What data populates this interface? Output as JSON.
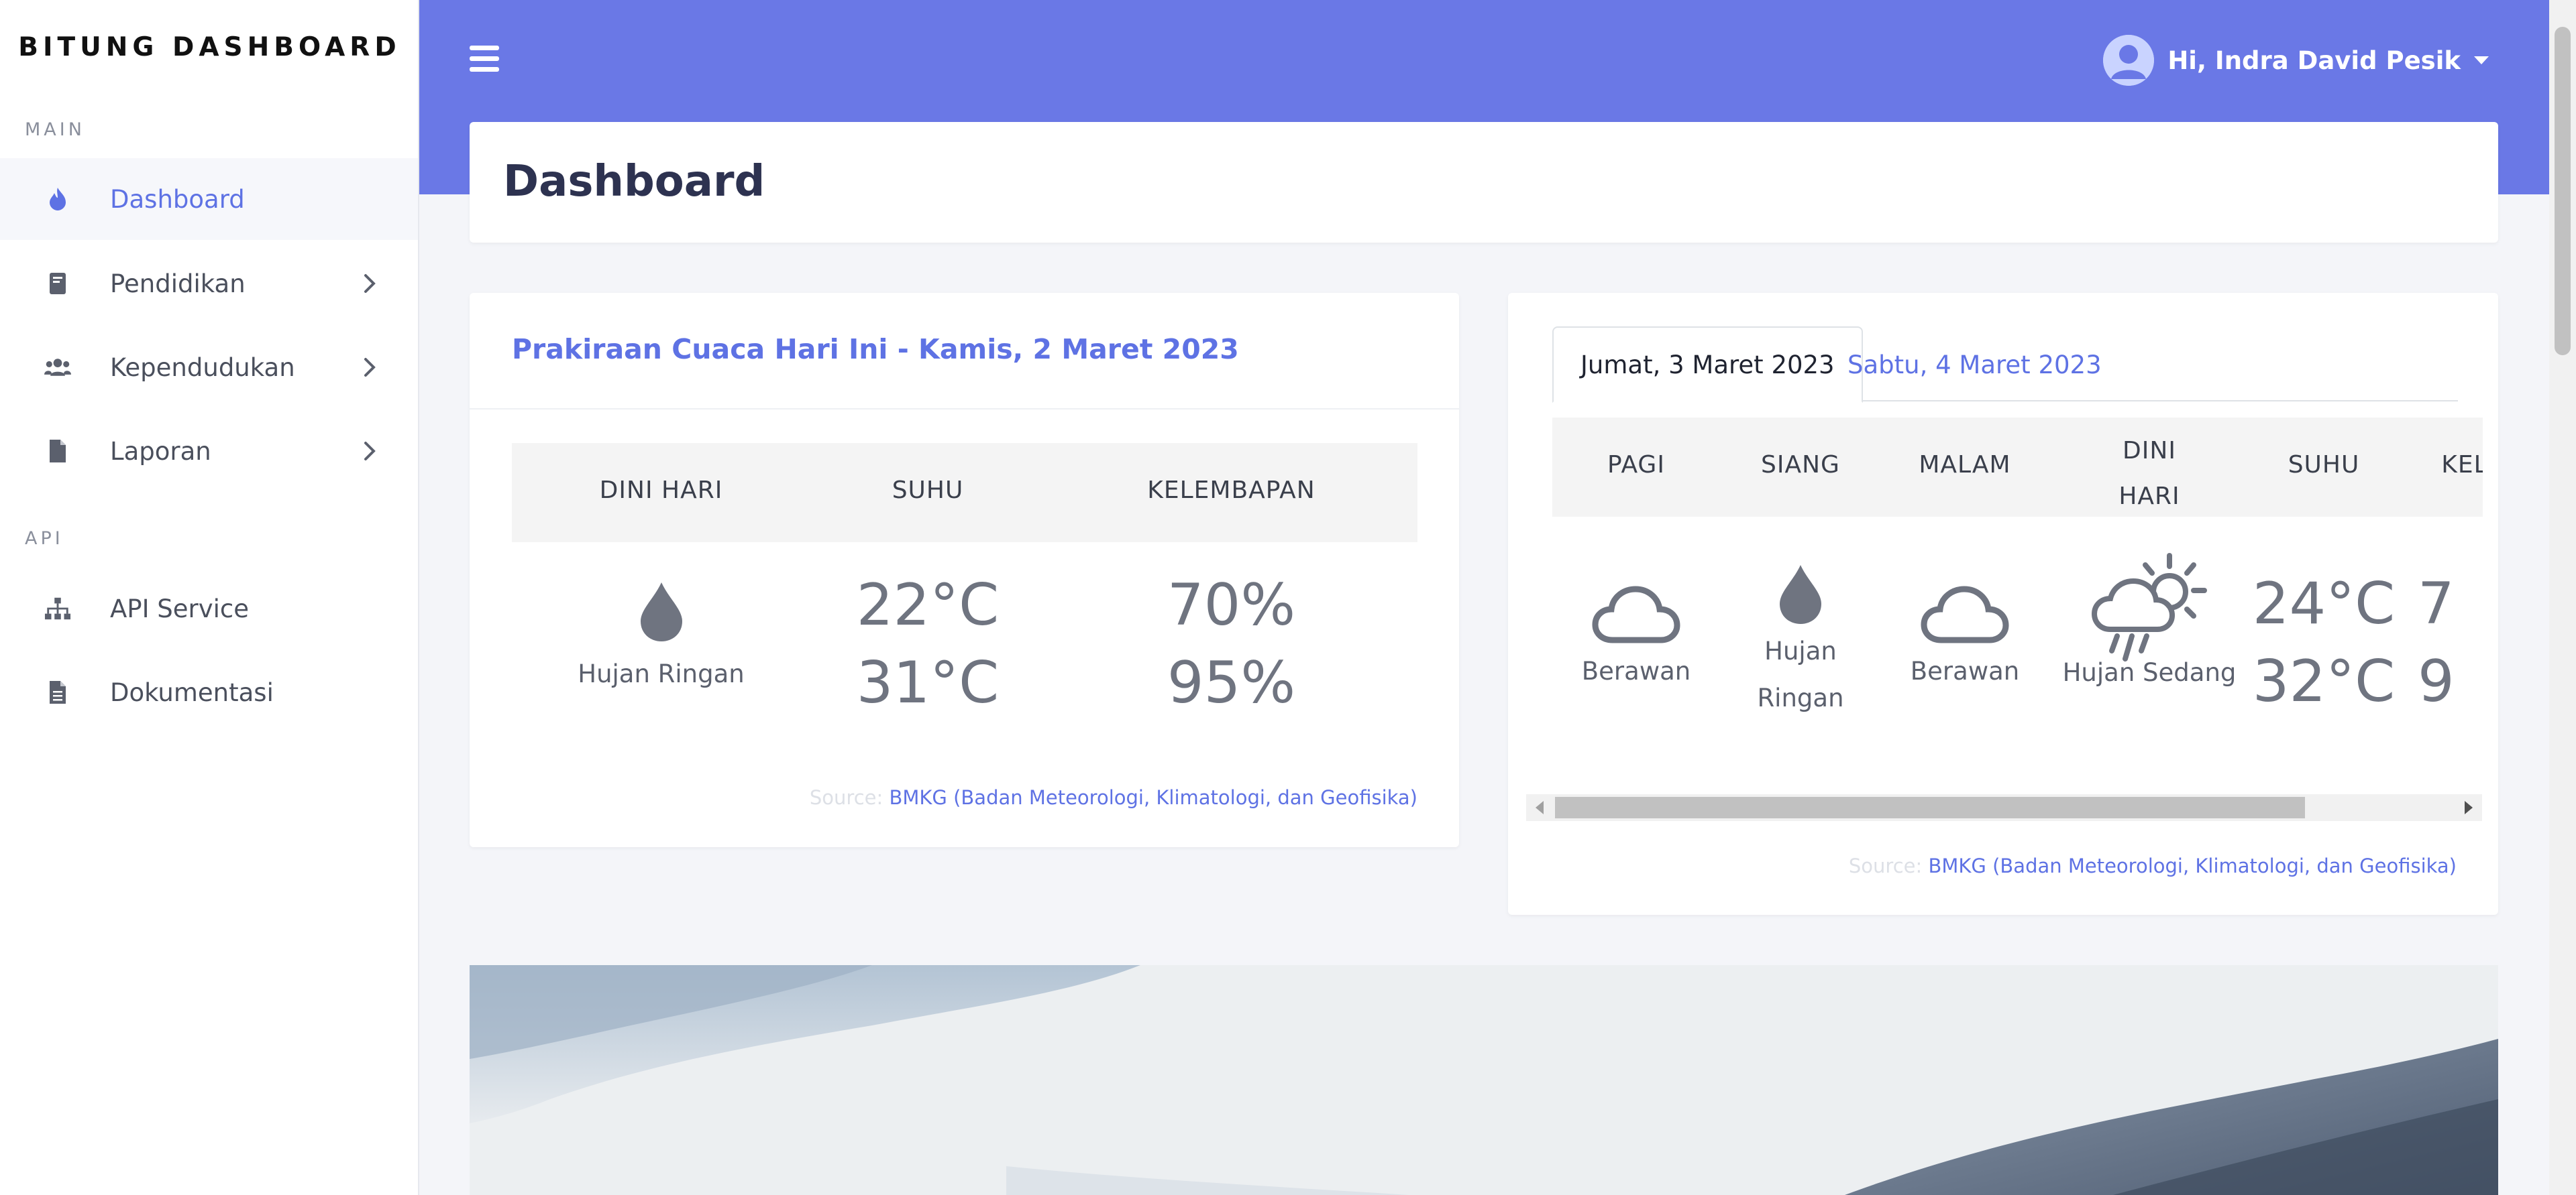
{
  "sidebar": {
    "brand": "BITUNG DASHBOARD",
    "section_main": "MAIN",
    "section_api": "API",
    "items": [
      {
        "label": "Dashboard",
        "icon": "fire-icon"
      },
      {
        "label": "Pendidikan",
        "icon": "book-icon"
      },
      {
        "label": "Kependudukan",
        "icon": "users-icon"
      },
      {
        "label": "Laporan",
        "icon": "file-icon"
      },
      {
        "label": "API Service",
        "icon": "sitemap-icon"
      },
      {
        "label": "Dokumentasi",
        "icon": "document-icon"
      }
    ]
  },
  "header": {
    "user_greeting": "Hi, Indra David Pesik"
  },
  "page": {
    "title": "Dashboard"
  },
  "today_card": {
    "title": "Prakiraan Cuaca Hari Ini - Kamis, 2 Maret 2023",
    "columns": [
      "DINI HARI",
      "SUHU",
      "KELEMBAPAN"
    ],
    "weather": {
      "icon": "raindrop-icon",
      "label": "Hujan Ringan"
    },
    "temp_min": "22°C",
    "temp_max": "31°C",
    "humidity_min": "70%",
    "humidity_max": "95%",
    "source_label": "Source:",
    "source_link": "BMKG (Badan Meteorologi, Klimatologi, dan Geofisika)"
  },
  "forecast_card": {
    "tabs": [
      "Jumat, 3 Maret 2023",
      "Sabtu, 4 Maret 2023"
    ],
    "columns": [
      "PAGI",
      "SIANG",
      "MALAM",
      "DINI HARI",
      "SUHU",
      "KEL"
    ],
    "column_dini_line1": "DINI",
    "column_dini_line2": "HARI",
    "pagi": {
      "icon": "cloud-icon",
      "label": "Berawan"
    },
    "siang": {
      "icon": "raindrop-icon",
      "label_line1": "Hujan",
      "label_line2": "Ringan"
    },
    "malam": {
      "icon": "cloud-icon",
      "label": "Berawan"
    },
    "dini": {
      "icon": "cloud-sun-rain-icon",
      "label": "Hujan Sedang"
    },
    "temp_min": "24°C",
    "temp_max": "32°C",
    "kel_partial_1": "7",
    "kel_partial_2": "9",
    "source_label": "Source:",
    "source_link": "BMKG (Badan Meteorologi, Klimatologi, dan Geofisika)"
  },
  "colors": {
    "accent": "#5e72e4",
    "header_band": "#6a78e6",
    "icon_gray": "#6f7480"
  }
}
